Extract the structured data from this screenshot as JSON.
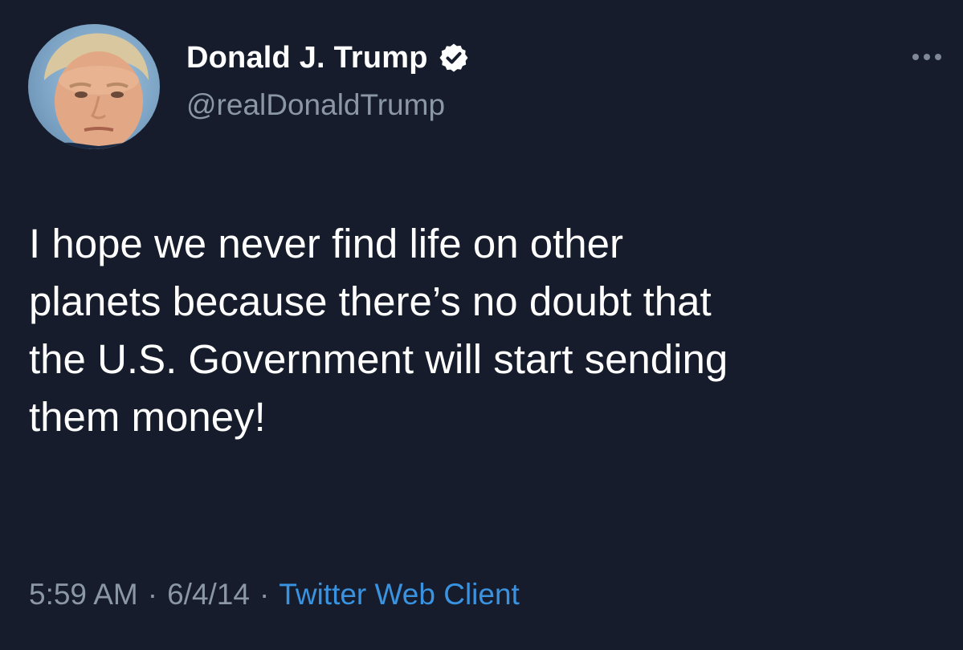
{
  "tweet": {
    "author": {
      "display_name": "Donald J. Trump",
      "handle": "@realDonaldTrump",
      "verified": true,
      "avatar_icon": "profile-photo"
    },
    "more_icon": "ellipsis-icon",
    "text_lines": [
      "I hope we never find life on other",
      "planets because there’s no doubt that",
      "the U.S. Government will start sending",
      "them money!"
    ],
    "time": "5:59 AM",
    "date": "6/4/14",
    "separator": "·",
    "source": "Twitter Web Client"
  },
  "colors": {
    "background": "#161c2b",
    "text": "#ffffff",
    "muted": "#8b97a5",
    "link": "#3a93e0"
  }
}
